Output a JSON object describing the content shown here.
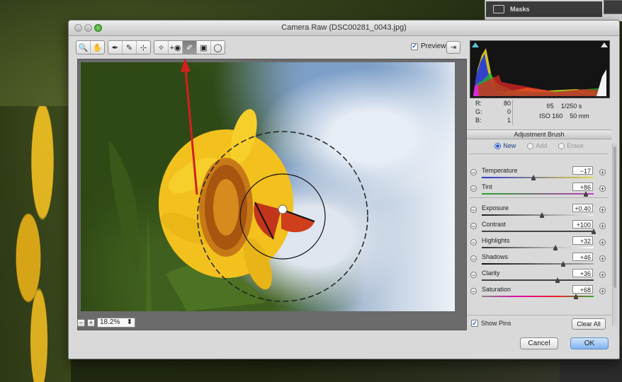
{
  "background": {
    "ps_panel_label": "Masks"
  },
  "window": {
    "title": "Camera Raw (DSC00281_0043.jpg)"
  },
  "toolbar": {
    "tools": [
      {
        "name": "zoom-tool",
        "icon": "🔍"
      },
      {
        "name": "hand-tool",
        "icon": "✋"
      },
      {
        "name": "white-balance-tool",
        "icon": "✒"
      },
      {
        "name": "color-sampler-tool",
        "icon": "✎"
      },
      {
        "name": "targeted-adjustment-tool",
        "icon": "⊹"
      },
      {
        "name": "crop-tool",
        "icon": "⌗"
      },
      {
        "name": "spot-removal-tool",
        "icon": "✧"
      },
      {
        "name": "red-eye-tool",
        "icon": "+◉"
      },
      {
        "name": "adjustment-brush-tool",
        "icon": "✐"
      },
      {
        "name": "graduated-filter-tool",
        "icon": "▣"
      },
      {
        "name": "radial-filter-tool",
        "icon": "◯"
      }
    ],
    "preview_label": "Preview",
    "preview_checked": "✓"
  },
  "zoom": {
    "level": "18.2%",
    "minus": "−",
    "plus": "+",
    "arrows": "⬍"
  },
  "readout": {
    "r_label": "R:",
    "r": "80",
    "g_label": "G:",
    "g": "0",
    "b_label": "B:",
    "b": "1",
    "aperture": "f/5",
    "shutter": "1/250 s",
    "iso": "ISO 160",
    "focal": "50 mm"
  },
  "panel": {
    "title": "Adjustment Brush",
    "modes": [
      "New",
      "Add",
      "Erase"
    ],
    "selected_mode": "New",
    "sliders": [
      {
        "label": "Temperature",
        "value": "−17",
        "pos": 0.46,
        "track": "linear-gradient(90deg,#2e35d8,#e7da3a)"
      },
      {
        "label": "Tint",
        "value": "+86",
        "pos": 0.93,
        "track": "linear-gradient(90deg,#2aa32a,#c23bc3)"
      },
      {
        "label": "Exposure",
        "value": "+0.40",
        "pos": 0.54,
        "track": "linear-gradient(90deg,#222,#eee)"
      },
      {
        "label": "Contrast",
        "value": "+100",
        "pos": 1.0,
        "track": "linear-gradient(90deg,#444,#444)"
      },
      {
        "label": "Highlights",
        "value": "+32",
        "pos": 0.66,
        "track": "linear-gradient(90deg,#333,#fff)"
      },
      {
        "label": "Shadows",
        "value": "+46",
        "pos": 0.73,
        "track": "linear-gradient(90deg,#111,#aaa)"
      },
      {
        "label": "Clarity",
        "value": "+36",
        "pos": 0.68,
        "track": "linear-gradient(90deg,#444,#444)"
      },
      {
        "label": "Saturation",
        "value": "+68",
        "pos": 0.84,
        "track": "linear-gradient(90deg,#888,#d0a,#e22,#3a3)"
      }
    ],
    "show_pins_label": "Show Pins",
    "show_pins_checked": "✓",
    "clear_all_label": "Clear All"
  },
  "dialog": {
    "cancel_label": "Cancel",
    "ok_label": "OK"
  },
  "colors": {
    "annotation_arrow": "#d0211c",
    "ok_button": "#7fb3ee"
  }
}
